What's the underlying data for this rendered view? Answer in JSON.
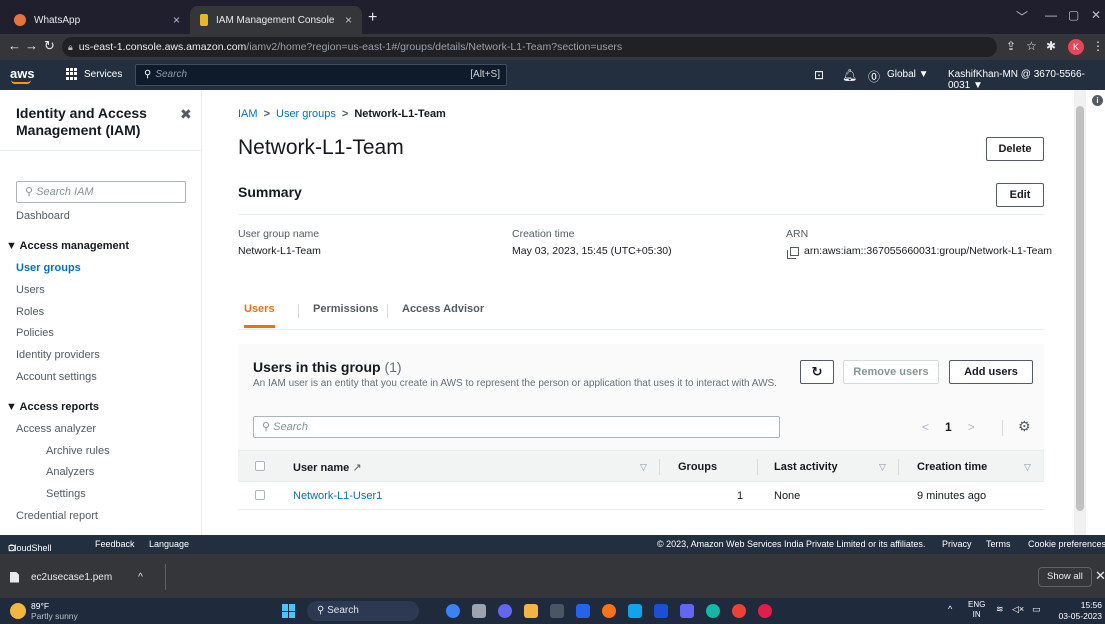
{
  "browser": {
    "tabs": [
      {
        "title": "WhatsApp",
        "close": "×"
      },
      {
        "title": "IAM Management Console",
        "close": "×"
      }
    ],
    "new_tab": "+",
    "url_host": "us-east-1.console.aws.amazon.com",
    "url_path": "/iamv2/home?region=us-east-1#/groups/details/Network-L1-Team?section=users",
    "profile_initial": "K"
  },
  "aws_nav": {
    "logo": "aws",
    "services": "Services",
    "search_placeholder": "Search",
    "search_shortcut": "[Alt+S]",
    "region": "Global ▼",
    "account": "KashifKhan-MN @ 3670-5566-0031 ▼"
  },
  "sidebar": {
    "title": "Identity and Access Management (IAM)",
    "search_placeholder": "Search IAM",
    "dashboard": "Dashboard",
    "access_management": "Access management",
    "user_groups": "User groups",
    "users": "Users",
    "roles": "Roles",
    "policies": "Policies",
    "identity_providers": "Identity providers",
    "account_settings": "Account settings",
    "access_reports": "Access reports",
    "access_analyzer": "Access analyzer",
    "archive_rules": "Archive rules",
    "analyzers": "Analyzers",
    "settings": "Settings",
    "credential_report": "Credential report"
  },
  "breadcrumb": {
    "iam": "IAM",
    "user_groups": "User groups",
    "current": "Network-L1-Team",
    "sep": ">"
  },
  "page": {
    "title": "Network-L1-Team",
    "delete": "Delete"
  },
  "summary": {
    "title": "Summary",
    "edit": "Edit",
    "group_name_label": "User group name",
    "group_name": "Network-L1-Team",
    "creation_label": "Creation time",
    "creation": "May 03, 2023, 15:45 (UTC+05:30)",
    "arn_label": "ARN",
    "arn": "arn:aws:iam::367055660031:group/Network-L1-Team"
  },
  "tabs": {
    "users": "Users",
    "permissions": "Permissions",
    "access_advisor": "Access Advisor"
  },
  "users_panel": {
    "title": "Users in this group",
    "count": "(1)",
    "description": "An IAM user is an entity that you create in AWS to represent the person or application that uses it to interact with AWS.",
    "remove": "Remove users",
    "add": "Add users",
    "search_placeholder": "Search",
    "page": "1",
    "columns": {
      "user_name": "User name",
      "groups": "Groups",
      "last_activity": "Last activity",
      "creation_time": "Creation time"
    },
    "rows": [
      {
        "user_name": "Network-L1-User1",
        "groups": "1",
        "last_activity": "None",
        "creation_time": "9 minutes ago"
      }
    ]
  },
  "footer": {
    "cloudshell": "CloudShell",
    "feedback": "Feedback",
    "language": "Language",
    "copyright": "© 2023, Amazon Web Services India Private Limited or its affiliates.",
    "privacy": "Privacy",
    "terms": "Terms",
    "cookies": "Cookie preferences"
  },
  "downloads": {
    "file": "ec2usecase1.pem",
    "show_all": "Show all"
  },
  "taskbar": {
    "temp": "89°F",
    "weather": "Partly sunny",
    "search": "Search",
    "lang_top": "ENG",
    "lang_bottom": "IN",
    "time": "15:56",
    "date": "03-05-2023"
  },
  "colors": {
    "aws_dark": "#232f3e",
    "link": "#0073bb",
    "accent": "#ec7211"
  }
}
